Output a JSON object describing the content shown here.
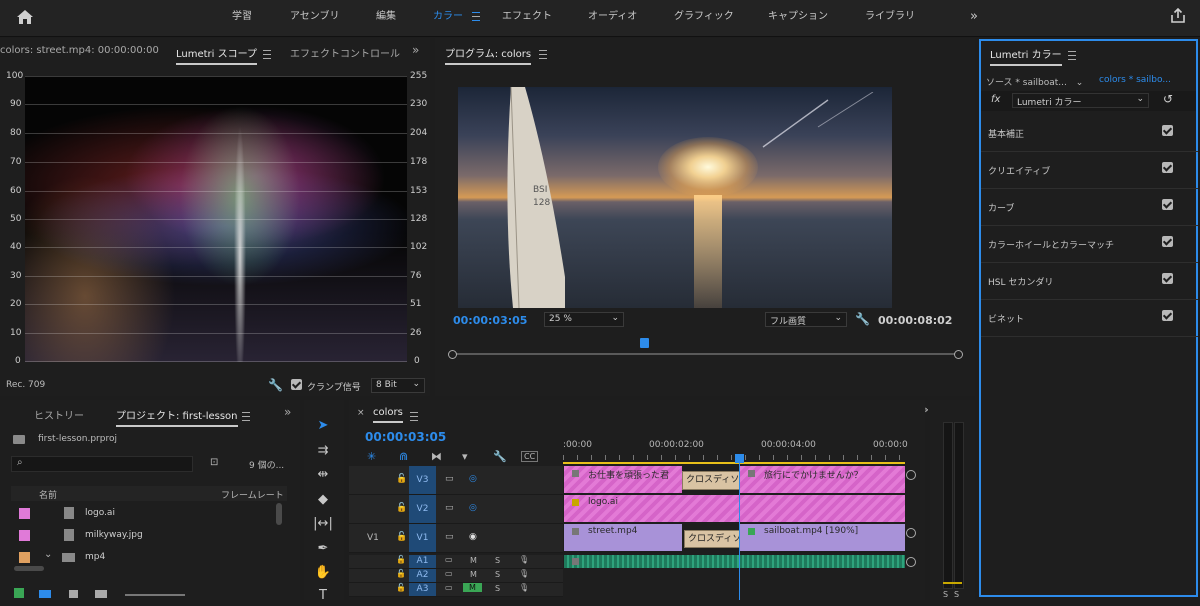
{
  "workspaces": [
    "学習",
    "アセンブリ",
    "編集",
    "カラー",
    "エフェクト",
    "オーディオ",
    "グラフィック",
    "キャプション",
    "ライブラリ"
  ],
  "active_workspace": "カラー",
  "scope_panel": {
    "tab_source": "colors: street.mp4: 00:00:00:00",
    "tab_scopes": "Lumetri スコープ",
    "tab_effect_controls": "エフェクトコントロール",
    "left_ticks": [
      "100",
      "90",
      "80",
      "70",
      "60",
      "50",
      "40",
      "30",
      "20",
      "10",
      "0"
    ],
    "right_ticks": [
      "255",
      "230",
      "204",
      "178",
      "153",
      "128",
      "102",
      "76",
      "51",
      "26",
      "0"
    ],
    "colorspace": "Rec. 709",
    "clamp_label": "クランプ信号",
    "bit_depth": "8 Bit"
  },
  "program": {
    "title": "プログラム: colors",
    "timecode": "00:00:03:05",
    "zoom": "25 %",
    "quality": "フル画質",
    "duration": "00:00:08:02",
    "playhead_fraction": 0.38
  },
  "lumetri": {
    "title": "Lumetri カラー",
    "source_label": "ソース * sailboat...",
    "target_label": "colors * sailbo...",
    "fx_label": "fx",
    "effect_name": "Lumetri カラー",
    "sections": [
      {
        "label": "基本補正",
        "checked": true
      },
      {
        "label": "クリエイティブ",
        "checked": true
      },
      {
        "label": "カーブ",
        "checked": true
      },
      {
        "label": "カラーホイールとカラーマッチ",
        "checked": true
      },
      {
        "label": "HSL セカンダリ",
        "checked": true
      },
      {
        "label": "ビネット",
        "checked": true
      }
    ]
  },
  "project": {
    "tab_history": "ヒストリー",
    "tab_project": "プロジェクト: first-lesson",
    "file_name": "first-lesson.prproj",
    "item_count": "9 個の...",
    "col_name": "名前",
    "col_framerate": "フレームレート",
    "items": [
      {
        "name": "logo.ai",
        "color": "#e07ad8",
        "type": "image"
      },
      {
        "name": "milkyway.jpg",
        "color": "#e07ad8",
        "type": "image"
      },
      {
        "name": "mp4",
        "color": "#e0a060",
        "type": "folder"
      }
    ]
  },
  "timeline": {
    "tab": "colors",
    "timecode": "00:00:03:05",
    "ruler": [
      ":00:00",
      "00:00:02:00",
      "00:00:04:00",
      "00:00:0"
    ],
    "tracks": [
      {
        "id": "V3",
        "src": ""
      },
      {
        "id": "V2",
        "src": ""
      },
      {
        "id": "V1",
        "src": "V1"
      },
      {
        "id": "A1",
        "src": ""
      },
      {
        "id": "A2",
        "src": ""
      },
      {
        "id": "A3",
        "src": ""
      }
    ],
    "clips": {
      "v3_a": "お仕事を頑張った君",
      "v3_trans": "クロスディソ",
      "v3_b": "旅行にでかけませんか？",
      "v2": "logo.ai",
      "v1_a": "street.mp4",
      "v1_trans": "クロスディソ",
      "v1_b": "sailboat.mp4 [190%]"
    },
    "track_letters": {
      "m": "M",
      "s": "S"
    },
    "meter_labels": [
      "S",
      "S"
    ]
  }
}
